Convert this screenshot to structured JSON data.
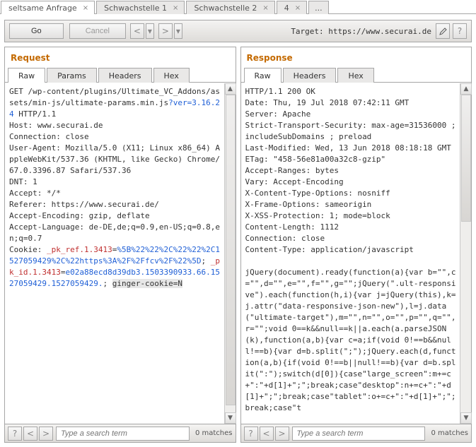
{
  "dossier_tabs": [
    {
      "label": "seltsame Anfrage",
      "active": true,
      "closeable": true
    },
    {
      "label": "Schwachstelle 1",
      "active": false,
      "closeable": true
    },
    {
      "label": "Schwachstelle 2",
      "active": false,
      "closeable": true
    },
    {
      "label": "4",
      "active": false,
      "closeable": true
    },
    {
      "label": "...",
      "active": false,
      "closeable": false
    }
  ],
  "toolbar": {
    "go": "Go",
    "cancel": "Cancel",
    "target_prefix": "Target: ",
    "target_url": "https://www.securai.de"
  },
  "request": {
    "title": "Request",
    "tabs": [
      "Raw",
      "Params",
      "Headers",
      "Hex"
    ],
    "active_tab": "Raw",
    "search_placeholder": "Type a search term",
    "matches": "0 matches",
    "raw_segments": [
      {
        "t": "plain",
        "v": "GET /wp-content/plugins/Ultimate_VC_Addons/assets/min-js/ultimate-params.min.js"
      },
      {
        "t": "blue",
        "v": "?ver=3.16.24"
      },
      {
        "t": "plain",
        "v": " HTTP/1.1\nHost: www.securai.de\nConnection: close\nUser-Agent: Mozilla/5.0 (X11; Linux x86_64) AppleWebKit/537.36 (KHTML, like Gecko) Chrome/67.0.3396.87 Safari/537.36\nDNT: 1\nAccept: */*\nReferer: https://www.securai.de/\nAccept-Encoding: gzip, deflate\nAccept-Language: de-DE,de;q=0.9,en-US;q=0.8,en;q=0.7\nCookie: "
      },
      {
        "t": "red",
        "v": "_pk_ref.1.3413"
      },
      {
        "t": "plain",
        "v": "="
      },
      {
        "t": "blue",
        "v": "%5B%22%22%2C%22%22%2C1527059429%2C%22https%3A%2F%2Ffcv%2F%22%5D"
      },
      {
        "t": "plain",
        "v": "; "
      },
      {
        "t": "red",
        "v": "_pk_id.1.3413"
      },
      {
        "t": "plain",
        "v": "="
      },
      {
        "t": "blue",
        "v": "e02a88ecd8d39db3.1503390933.66.1527059429.1527059429."
      },
      {
        "t": "plain",
        "v": "; "
      },
      {
        "t": "hl",
        "v": "ginger-cookie=N"
      }
    ]
  },
  "response": {
    "title": "Response",
    "tabs": [
      "Raw",
      "Headers",
      "Hex"
    ],
    "active_tab": "Raw",
    "search_placeholder": "Type a search term",
    "matches": "0 matches",
    "raw": "HTTP/1.1 200 OK\nDate: Thu, 19 Jul 2018 07:42:11 GMT\nServer: Apache\nStrict-Transport-Security: max-age=31536000 ; includeSubDomains ; preload\nLast-Modified: Wed, 13 Jun 2018 08:18:18 GMT\nETag: \"458-56e81a00a32c8-gzip\"\nAccept-Ranges: bytes\nVary: Accept-Encoding\nX-Content-Type-Options: nosniff\nX-Frame-Options: sameorigin\nX-XSS-Protection: 1; mode=block\nContent-Length: 1112\nConnection: close\nContent-Type: application/javascript\n\njQuery(document).ready(function(a){var b=\"\",c=\"\",d=\"\",e=\"\",f=\"\",g=\"\";jQuery(\".ult-responsive\").each(function(h,i){var j=jQuery(this),k=j.attr(\"data-responsive-json-new\"),l=j.data(\"ultimate-target\"),m=\"\",n=\"\",o=\"\",p=\"\",q=\"\",r=\"\";void 0==k&&null==k||a.each(a.parseJSON(k),function(a,b){var c=a;if(void 0!==b&&null!==b){var d=b.split(\";\");jQuery.each(d,function(a,b){if(void 0!==b||null!==b){var d=b.split(\":\");switch(d[0]){case\"large_screen\":m+=c+\":\"+d[1]+\";\";break;case\"desktop\":n+=c+\":\"+d[1]+\";\";break;case\"tablet\":o+=c+\":\"+d[1]+\";\";break;case\"t"
  }
}
